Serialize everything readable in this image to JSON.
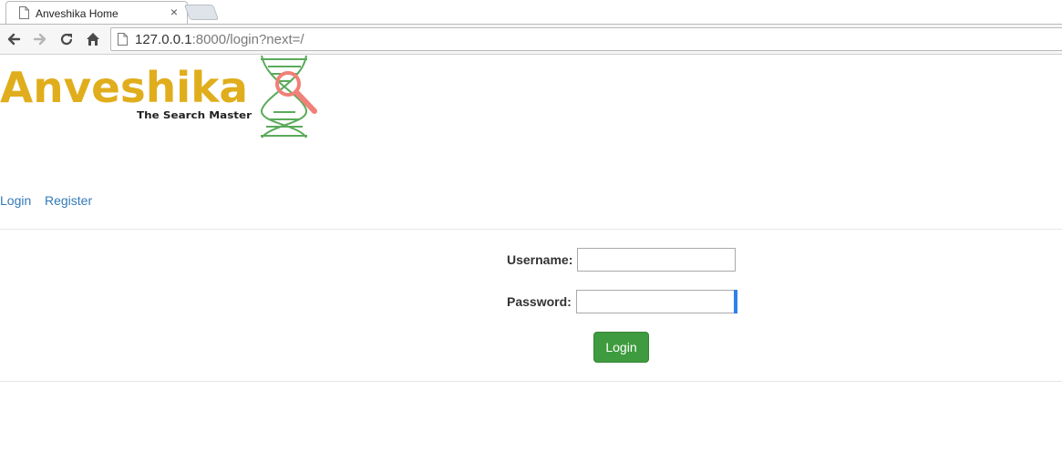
{
  "browser": {
    "tab_title": "Anveshika Home",
    "close_glyph": "×",
    "url_host": "127.0.0.1",
    "url_rest": ":8000/login?next=/"
  },
  "logo": {
    "name": "Anveshika",
    "tagline": "The Search Master",
    "brand_color": "#e0ad1c",
    "dna_color": "#5aab5a",
    "magnifier_color": "#f08078"
  },
  "nav": {
    "login": "Login",
    "register": "Register"
  },
  "form": {
    "username_label": "Username:",
    "username_value": "",
    "password_label": "Password:",
    "password_value": "",
    "submit_label": "Login"
  },
  "colors": {
    "link": "#337ab7",
    "button": "#3f9b3f",
    "focus": "#2f80ed"
  }
}
